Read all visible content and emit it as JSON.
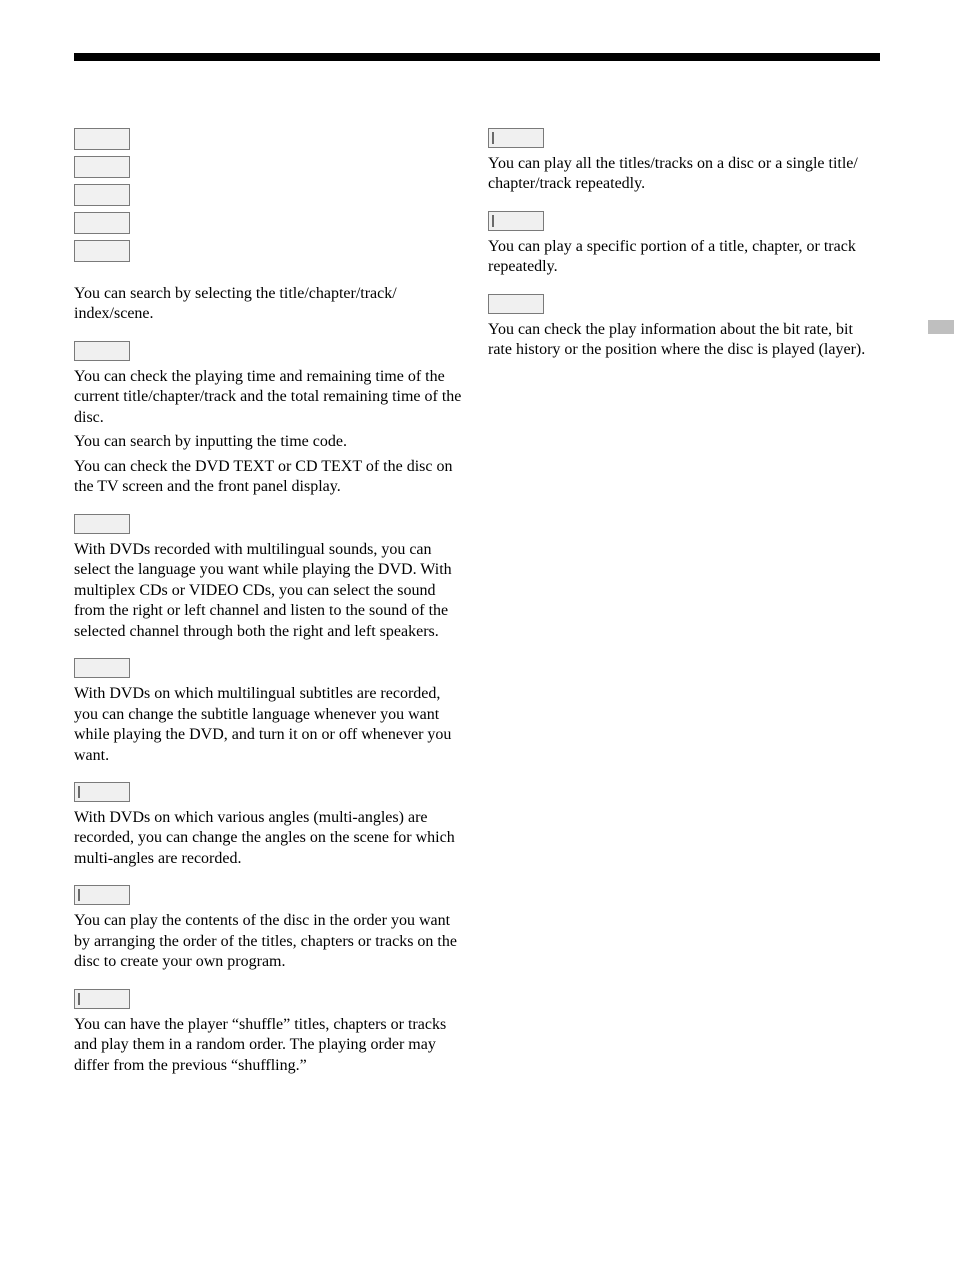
{
  "left": {
    "intro": "You can search by selecting the title/chapter/track/ index/scene.",
    "s1": {
      "p1": "You can check the playing time and remaining time of the current title/chapter/track and the total remaining time of the disc.",
      "p2": "You can search by inputting the time code.",
      "p3": "You can check the DVD TEXT or CD TEXT of the disc on the TV screen and the front panel display."
    },
    "s2": "With DVDs recorded with multilingual sounds, you can select the language you want while playing the DVD. With multiplex CDs or VIDEO CDs, you can select the sound from the right or left channel and listen to the sound of the selected channel through both the right and left speakers.",
    "s3": "With DVDs on which multilingual subtitles are recorded, you can change the subtitle language whenever you want while playing the DVD, and turn it on or off whenever you want.",
    "s4": "With DVDs on which various angles (multi-angles) are recorded, you can change the angles on the scene for which multi-angles are recorded.",
    "s5": "You can play the contents of the disc in the order you want by arranging the order of the titles, chapters or tracks on the disc to create your own program.",
    "s6": "You can have the player “shuffle” titles, chapters or tracks and play them in a random order.  The playing order may differ from the previous “shuffling.”"
  },
  "right": {
    "r1": "You can play all the titles/tracks on a disc or a single title/ chapter/track repeatedly.",
    "r2": "You can play a specific portion of a title, chapter, or track repeatedly.",
    "r3": "You can check the play information about the bit rate, bit rate history or the position where the disc is played (layer)."
  }
}
